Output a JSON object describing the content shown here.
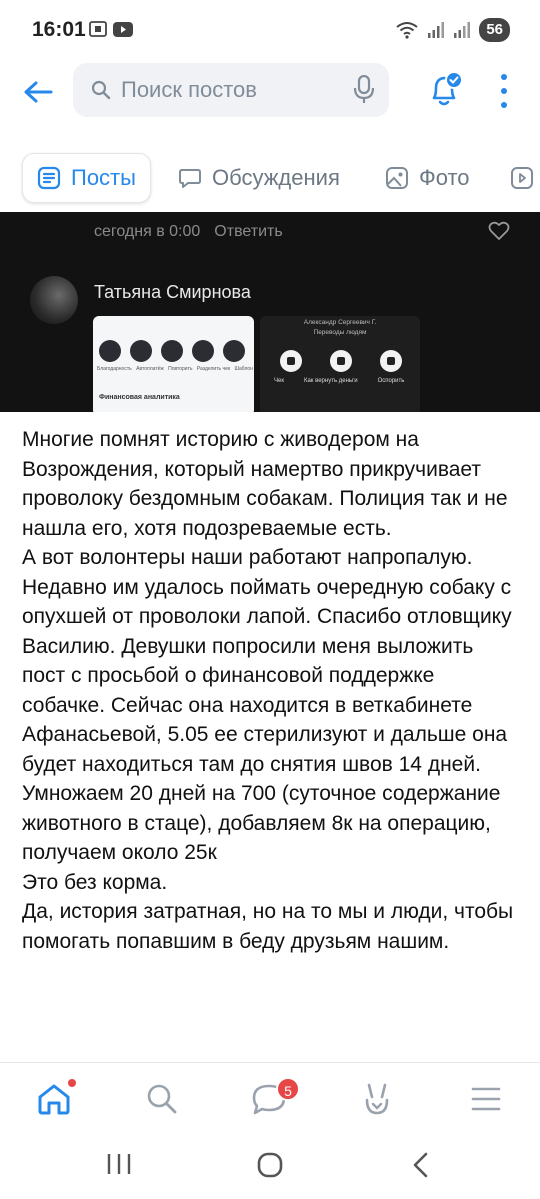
{
  "status_bar": {
    "time": "16:01",
    "battery": "56"
  },
  "search": {
    "placeholder": "Поиск постов"
  },
  "tabs": [
    {
      "label": "Посты",
      "active": true
    },
    {
      "label": "Обсуждения",
      "active": false
    },
    {
      "label": "Фото",
      "active": false
    }
  ],
  "comment": {
    "time": "сегодня в 0:00",
    "reply": "Ответить",
    "author": "Татьяна Смирнова"
  },
  "thumb1": {
    "captions": [
      "Благодарность",
      "Автоплатёж",
      "Повторить",
      "Разделить чек",
      "Шаблон"
    ],
    "section": "Финансовая аналитика"
  },
  "thumb2": {
    "name": "Александр Сергеевич Г.",
    "subtitle": "Переводы людям",
    "captions": [
      "Чек",
      "Как вернуть деньги",
      "Оспорить"
    ]
  },
  "post": {
    "text": "Многие помнят историю с живодером на Возрождения, который намертво прикручивает проволоку бездомным собакам. Полиция так и не нашла его, хотя подозреваемые есть.\nА вот волонтеры наши работают напропалую. Недавно им удалось поймать очередную собаку с опухшей от проволоки лапой. Спасибо отловщику Василию. Девушки попросили меня выложить пост с просьбой о финансовой поддержке собачке. Сейчас она находится в веткабинете Афанасьевой, 5.05 ее стерилизуют и дальше она будет находиться там до снятия швов 14 дней. Умножаем 20 дней на 700 (суточное содержание животного в стаце), добавляем 8к на операцию, получаем около 25к\nЭто без корма.\nДа, история затратная, но на то мы и люди, чтобы помогать попавшим в беду друзьям нашим."
  },
  "bottom_nav": {
    "messages_badge": "5",
    "items": [
      "home-icon",
      "search-icon",
      "messages-icon",
      "services-icon",
      "menu-icon"
    ]
  },
  "colors": {
    "accent": "#2688eb",
    "badge": "#e64646"
  }
}
